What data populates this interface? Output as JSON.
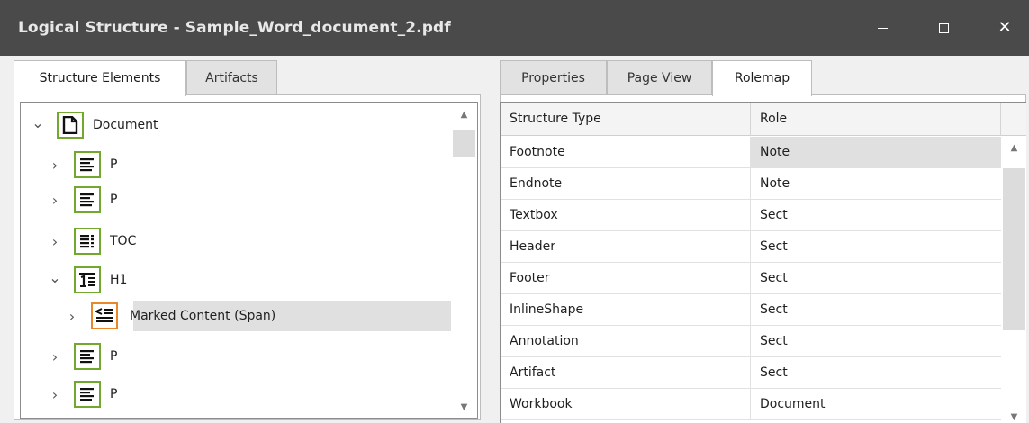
{
  "window": {
    "title": "Logical Structure - Sample_Word_document_2.pdf",
    "minimize_glyph": "—",
    "close_glyph": "✕"
  },
  "left_tabs": [
    {
      "label": "Structure Elements",
      "active": true
    },
    {
      "label": "Artifacts",
      "active": false
    }
  ],
  "tree": [
    {
      "label": "Document",
      "icon": "document-icon",
      "expanded": true,
      "level": 0
    },
    {
      "label": "P",
      "icon": "paragraph-icon",
      "expanded": false,
      "level": 1
    },
    {
      "label": "P",
      "icon": "paragraph-icon",
      "expanded": false,
      "level": 1
    },
    {
      "label": "TOC",
      "icon": "toc-icon",
      "expanded": false,
      "level": 1
    },
    {
      "label": "H1",
      "icon": "heading-icon",
      "expanded": true,
      "level": 1
    },
    {
      "label": "Marked Content (Span)",
      "icon": "marked-content-icon",
      "expanded": false,
      "level": 2,
      "selected": true
    },
    {
      "label": "P",
      "icon": "paragraph-icon",
      "expanded": false,
      "level": 1
    },
    {
      "label": "P",
      "icon": "paragraph-icon",
      "expanded": false,
      "level": 1
    }
  ],
  "right_tabs": [
    {
      "label": "Properties",
      "active": false
    },
    {
      "label": "Page View",
      "active": false
    },
    {
      "label": "Rolemap",
      "active": true
    }
  ],
  "rolemap": {
    "columns": [
      "Structure Type",
      "Role"
    ],
    "rows": [
      [
        "Footnote",
        "Note"
      ],
      [
        "Endnote",
        "Note"
      ],
      [
        "Textbox",
        "Sect"
      ],
      [
        "Header",
        "Sect"
      ],
      [
        "Footer",
        "Sect"
      ],
      [
        "InlineShape",
        "Sect"
      ],
      [
        "Annotation",
        "Sect"
      ],
      [
        "Artifact",
        "Sect"
      ],
      [
        "Workbook",
        "Document"
      ]
    ],
    "selected_cell": [
      0,
      1
    ]
  },
  "colors": {
    "titlebar": "#4a4a4a",
    "structure_border": "#72a82e",
    "content_border": "#e8882a",
    "selection": "#e0e0e0"
  }
}
